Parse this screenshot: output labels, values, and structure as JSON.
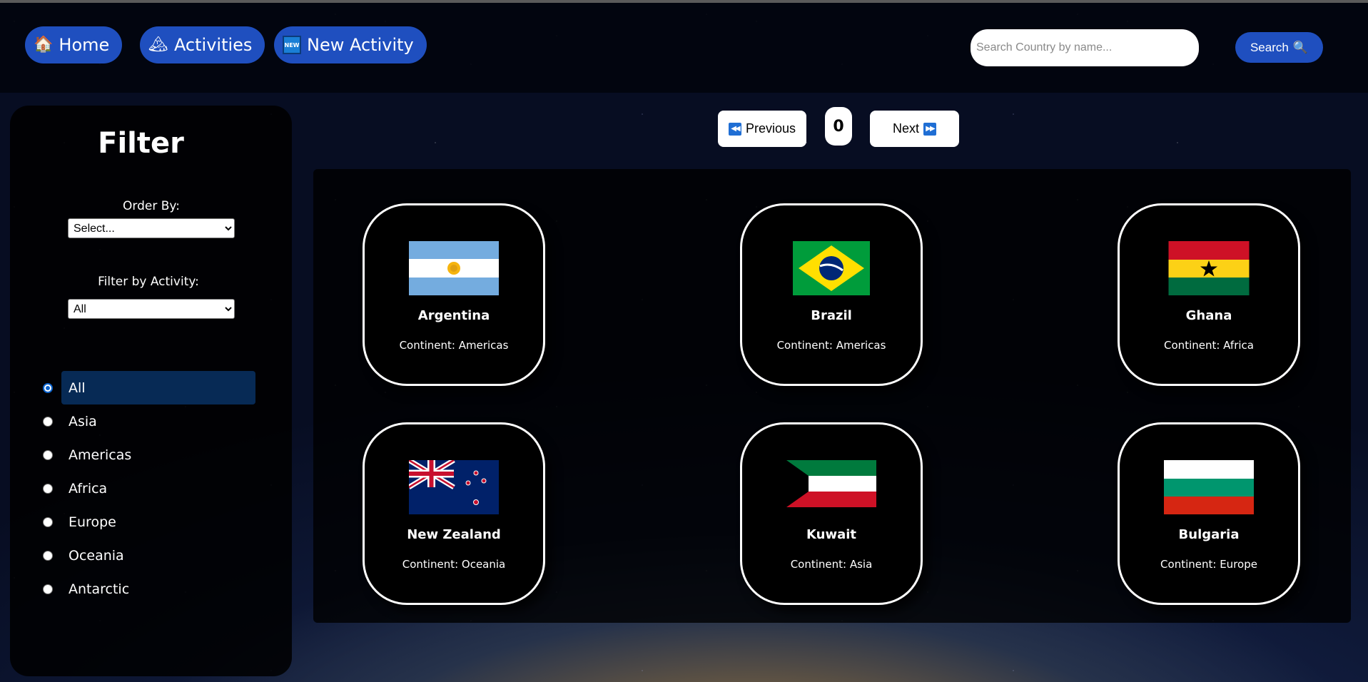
{
  "nav": {
    "home": {
      "label": "Home",
      "icon": "house-icon"
    },
    "activities": {
      "label": "Activities",
      "icon": "mountain-icon"
    },
    "new_activity": {
      "label": "New Activity",
      "icon": "new-badge-icon",
      "badge": "NEW"
    }
  },
  "search": {
    "placeholder": "Search Country by name...",
    "value": "",
    "button_label": "Search"
  },
  "sidebar": {
    "title": "Filter",
    "order_by": {
      "label": "Order By:",
      "selected": "Select..."
    },
    "activity": {
      "label": "Filter by Activity:",
      "selected": "All"
    },
    "continents": [
      {
        "label": "All",
        "checked": true
      },
      {
        "label": "Asia",
        "checked": false
      },
      {
        "label": "Americas",
        "checked": false
      },
      {
        "label": "Africa",
        "checked": false
      },
      {
        "label": "Europe",
        "checked": false
      },
      {
        "label": "Oceania",
        "checked": false
      },
      {
        "label": "Antarctic",
        "checked": false
      }
    ]
  },
  "pagination": {
    "previous_label": "Previous",
    "next_label": "Next",
    "page": "0"
  },
  "countries": [
    {
      "name": "Argentina",
      "continent_text": "Continent: Americas",
      "flag": "argentina-flag-icon"
    },
    {
      "name": "Brazil",
      "continent_text": "Continent: Americas",
      "flag": "brazil-flag-icon"
    },
    {
      "name": "Ghana",
      "continent_text": "Continent: Africa",
      "flag": "ghana-flag-icon"
    },
    {
      "name": "New Zealand",
      "continent_text": "Continent: Oceania",
      "flag": "new-zealand-flag-icon"
    },
    {
      "name": "Kuwait",
      "continent_text": "Continent: Asia",
      "flag": "kuwait-flag-icon"
    },
    {
      "name": "Bulgaria",
      "continent_text": "Continent: Europe",
      "flag": "bulgaria-flag-icon"
    }
  ],
  "colors": {
    "accent": "#1f4fbf",
    "selected_radio_bg": "#072a55"
  }
}
